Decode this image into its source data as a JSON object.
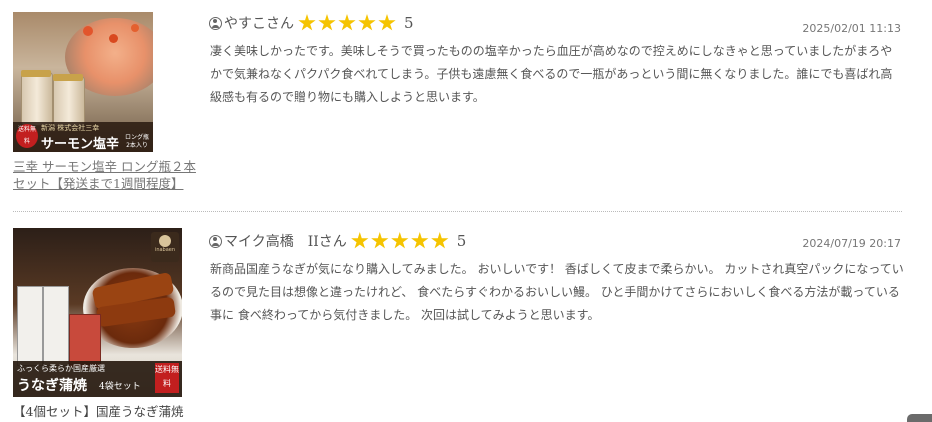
{
  "reviews": [
    {
      "product_link": "三幸 サーモン塩辛 ロング瓶２本セット【発送まで1週間程度】",
      "product_image": {
        "badge": "送料無料",
        "brand": "新潟 株式会社三幸",
        "name": "サーモン塩辛",
        "note": "ロング瓶 2本入り"
      },
      "user": "やすこさん",
      "stars": 5,
      "rating": "5",
      "date": "2025/02/01 11:13",
      "text": "凄く美味しかったです。美味しそうで買ったものの塩辛かったら血圧が高めなので控えめにしなきゃと思っていましたがまろやかで気兼ねなくパクパク食べれてしまう。子供も遠慮無く食べるので一瓶があっという間に無くなりました。誰にでも喜ばれ高級感も有るので贈り物にも購入しようと思います。"
    },
    {
      "product_link": "【4個セット】国産うなぎ蒲焼",
      "product_image": {
        "logo": "inabaen",
        "tagline": "ふっくら柔らか国産厳選",
        "name": "うなぎ蒲焼",
        "set": "4袋セット",
        "badge": "送料無料"
      },
      "user": "マイク高橋　IIさん",
      "stars": 5,
      "rating": "5",
      "date": "2024/07/19 20:17",
      "text": "新商品国産うなぎが気になり購入してみました。 おいしいです！ 香ばしくて皮まで柔らかい。 カットされ真空パックになっているので見た目は想像と違ったけれど、 食べたらすぐわかるおいしい鰻。 ひと手間かけてさらにおいしく食べる方法が載っている事に 食べ終わってから気付きました。 次回は試してみようと思います。"
    }
  ]
}
